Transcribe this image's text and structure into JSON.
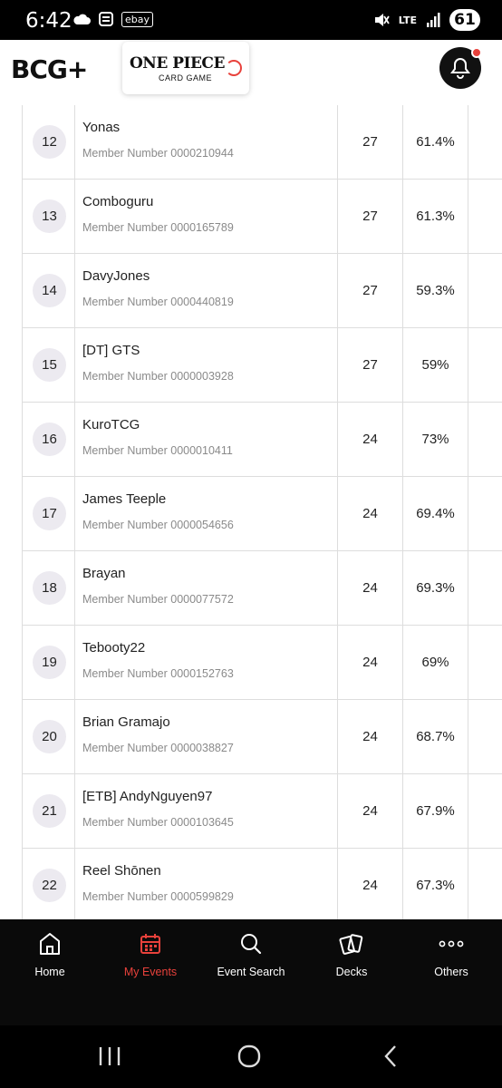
{
  "status_bar": {
    "time": "6:42",
    "ebay": "ebay",
    "network": "LTE",
    "battery": "61"
  },
  "header": {
    "logo_text": "BCG+",
    "partner_title": "ONE PIECE",
    "partner_subtitle": "CARD GAME"
  },
  "rows": [
    {
      "rank": "12",
      "name": "Yonas",
      "member": "Member Number 0000210944",
      "points": "27",
      "pct": "61.4%"
    },
    {
      "rank": "13",
      "name": "Comboguru",
      "member": "Member Number 0000165789",
      "points": "27",
      "pct": "61.3%"
    },
    {
      "rank": "14",
      "name": "DavyJones",
      "member": "Member Number 0000440819",
      "points": "27",
      "pct": "59.3%"
    },
    {
      "rank": "15",
      "name": "[DT] GTS",
      "member": "Member Number 0000003928",
      "points": "27",
      "pct": "59%"
    },
    {
      "rank": "16",
      "name": "KuroTCG",
      "member": "Member Number 0000010411",
      "points": "24",
      "pct": "73%"
    },
    {
      "rank": "17",
      "name": "James Teeple",
      "member": "Member Number 0000054656",
      "points": "24",
      "pct": "69.4%"
    },
    {
      "rank": "18",
      "name": "Brayan",
      "member": "Member Number 0000077572",
      "points": "24",
      "pct": "69.3%"
    },
    {
      "rank": "19",
      "name": "Tebooty22",
      "member": "Member Number 0000152763",
      "points": "24",
      "pct": "69%"
    },
    {
      "rank": "20",
      "name": "Brian Gramajo",
      "member": "Member Number 0000038827",
      "points": "24",
      "pct": "68.7%"
    },
    {
      "rank": "21",
      "name": "[ETB] AndyNguyen97",
      "member": "Member Number 0000103645",
      "points": "24",
      "pct": "67.9%"
    },
    {
      "rank": "22",
      "name": "Reel Shōnen",
      "member": "Member Number 0000599829",
      "points": "24",
      "pct": "67.3%"
    }
  ],
  "nav": {
    "items": [
      {
        "label": "Home",
        "icon": "home-icon"
      },
      {
        "label": "My Events",
        "icon": "calendar-icon",
        "active": true
      },
      {
        "label": "Event Search",
        "icon": "search-icon"
      },
      {
        "label": "Decks",
        "icon": "cards-icon"
      },
      {
        "label": "Others",
        "icon": "more-icon"
      }
    ]
  },
  "colors": {
    "accent": "#e8413b",
    "nav_bg": "#0a0a0a",
    "badge_bg": "#eceaf0",
    "border": "#dddddd"
  }
}
